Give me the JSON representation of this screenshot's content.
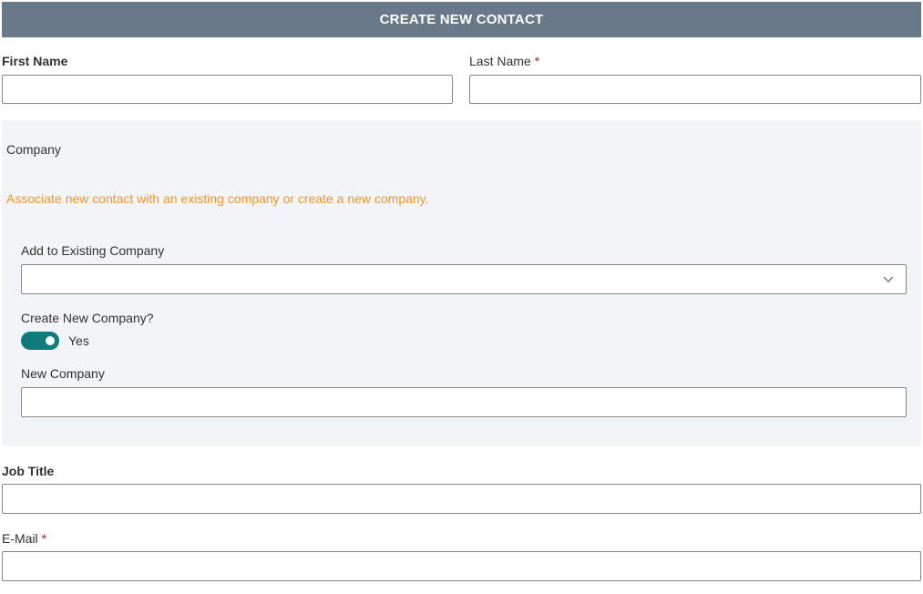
{
  "header": {
    "title": "CREATE NEW CONTACT"
  },
  "fields": {
    "first_name": {
      "label": "First Name",
      "value": ""
    },
    "last_name": {
      "label": "Last Name",
      "required_mark": "*",
      "value": ""
    },
    "job_title": {
      "label": "Job Title",
      "value": ""
    },
    "email": {
      "label": "E-Mail",
      "required_mark": "*",
      "value": ""
    }
  },
  "company": {
    "section_label": "Company",
    "hint": "Associate new contact with an existing company or create a new company.",
    "existing_label": "Add to Existing Company",
    "existing_value": "",
    "create_new_label": "Create New Company?",
    "toggle_on": true,
    "toggle_text": "Yes",
    "new_company_label": "New Company",
    "new_company_value": ""
  },
  "colors": {
    "header_bg": "#697987",
    "panel_bg": "#f2f5f8",
    "hint": "#f7941d",
    "toggle": "#0f7b7a",
    "required": "#a4262c"
  },
  "icons": {
    "dropdown": "chevron-down-icon"
  }
}
